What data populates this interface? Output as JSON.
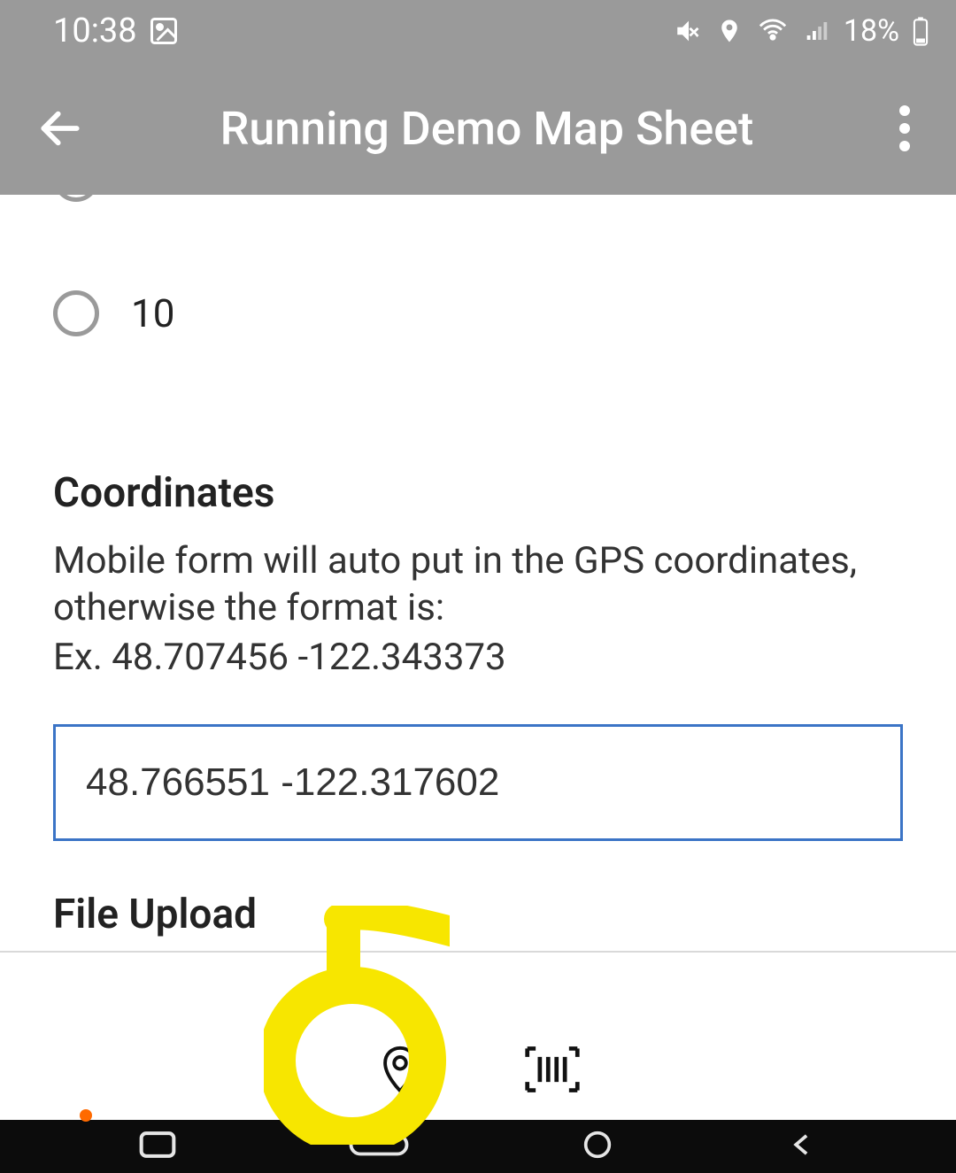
{
  "status": {
    "time": "10:38",
    "battery_pct": "18%"
  },
  "app_bar": {
    "title": "Running Demo Map Sheet"
  },
  "radios": {
    "option_prev_label": "",
    "option_10_label": "10"
  },
  "coordinates": {
    "heading": "Coordinates",
    "help_line1": "Mobile form will auto put in the GPS coordinates, otherwise the format is:",
    "help_line2": "Ex. 48.707456 -122.343373",
    "value": "48.766551 -122.317602"
  },
  "file_upload": {
    "heading": "File Upload"
  }
}
